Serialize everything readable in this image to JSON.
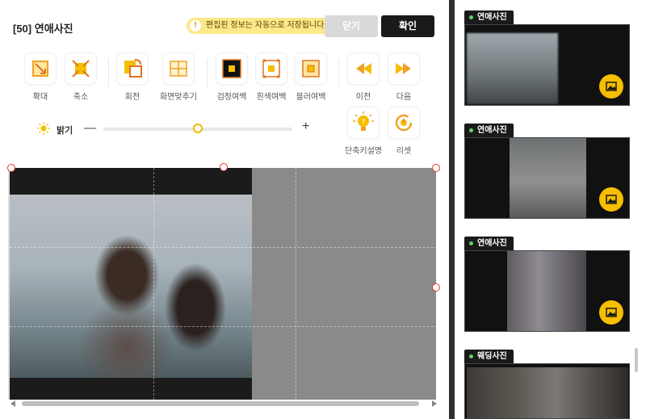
{
  "header": {
    "title": "[50] 연애사진",
    "notice": "편집된 정보는 자동으로 저장됩니다.",
    "close_label": "닫기",
    "confirm_label": "확인"
  },
  "tools": [
    {
      "label": "확대",
      "icon": "zoom-in-icon"
    },
    {
      "label": "축소",
      "icon": "zoom-out-icon"
    },
    {
      "label": "회전",
      "icon": "rotate-icon"
    },
    {
      "label": "화면맞추기",
      "icon": "fit-screen-icon"
    },
    {
      "label": "검정여백",
      "icon": "black-margin-icon"
    },
    {
      "label": "흰색여백",
      "icon": "white-margin-icon"
    },
    {
      "label": "블러여백",
      "icon": "blur-margin-icon"
    },
    {
      "label": "이전",
      "icon": "previous-icon"
    },
    {
      "label": "다음",
      "icon": "next-icon"
    },
    {
      "label": "단축키설명",
      "icon": "shortcut-help-icon"
    },
    {
      "label": "리셋",
      "icon": "reset-icon"
    }
  ],
  "brightness": {
    "label": "밝기",
    "minus": "—",
    "plus": "+",
    "value": 0.5
  },
  "thumbnails": [
    {
      "tag": "연애사진"
    },
    {
      "tag": "연애사진"
    },
    {
      "tag": "연애사진"
    },
    {
      "tag": "웨딩사진"
    }
  ],
  "colors": {
    "accent": "#f6be00",
    "dark": "#1a1a1a",
    "handle": "#e0352b"
  }
}
